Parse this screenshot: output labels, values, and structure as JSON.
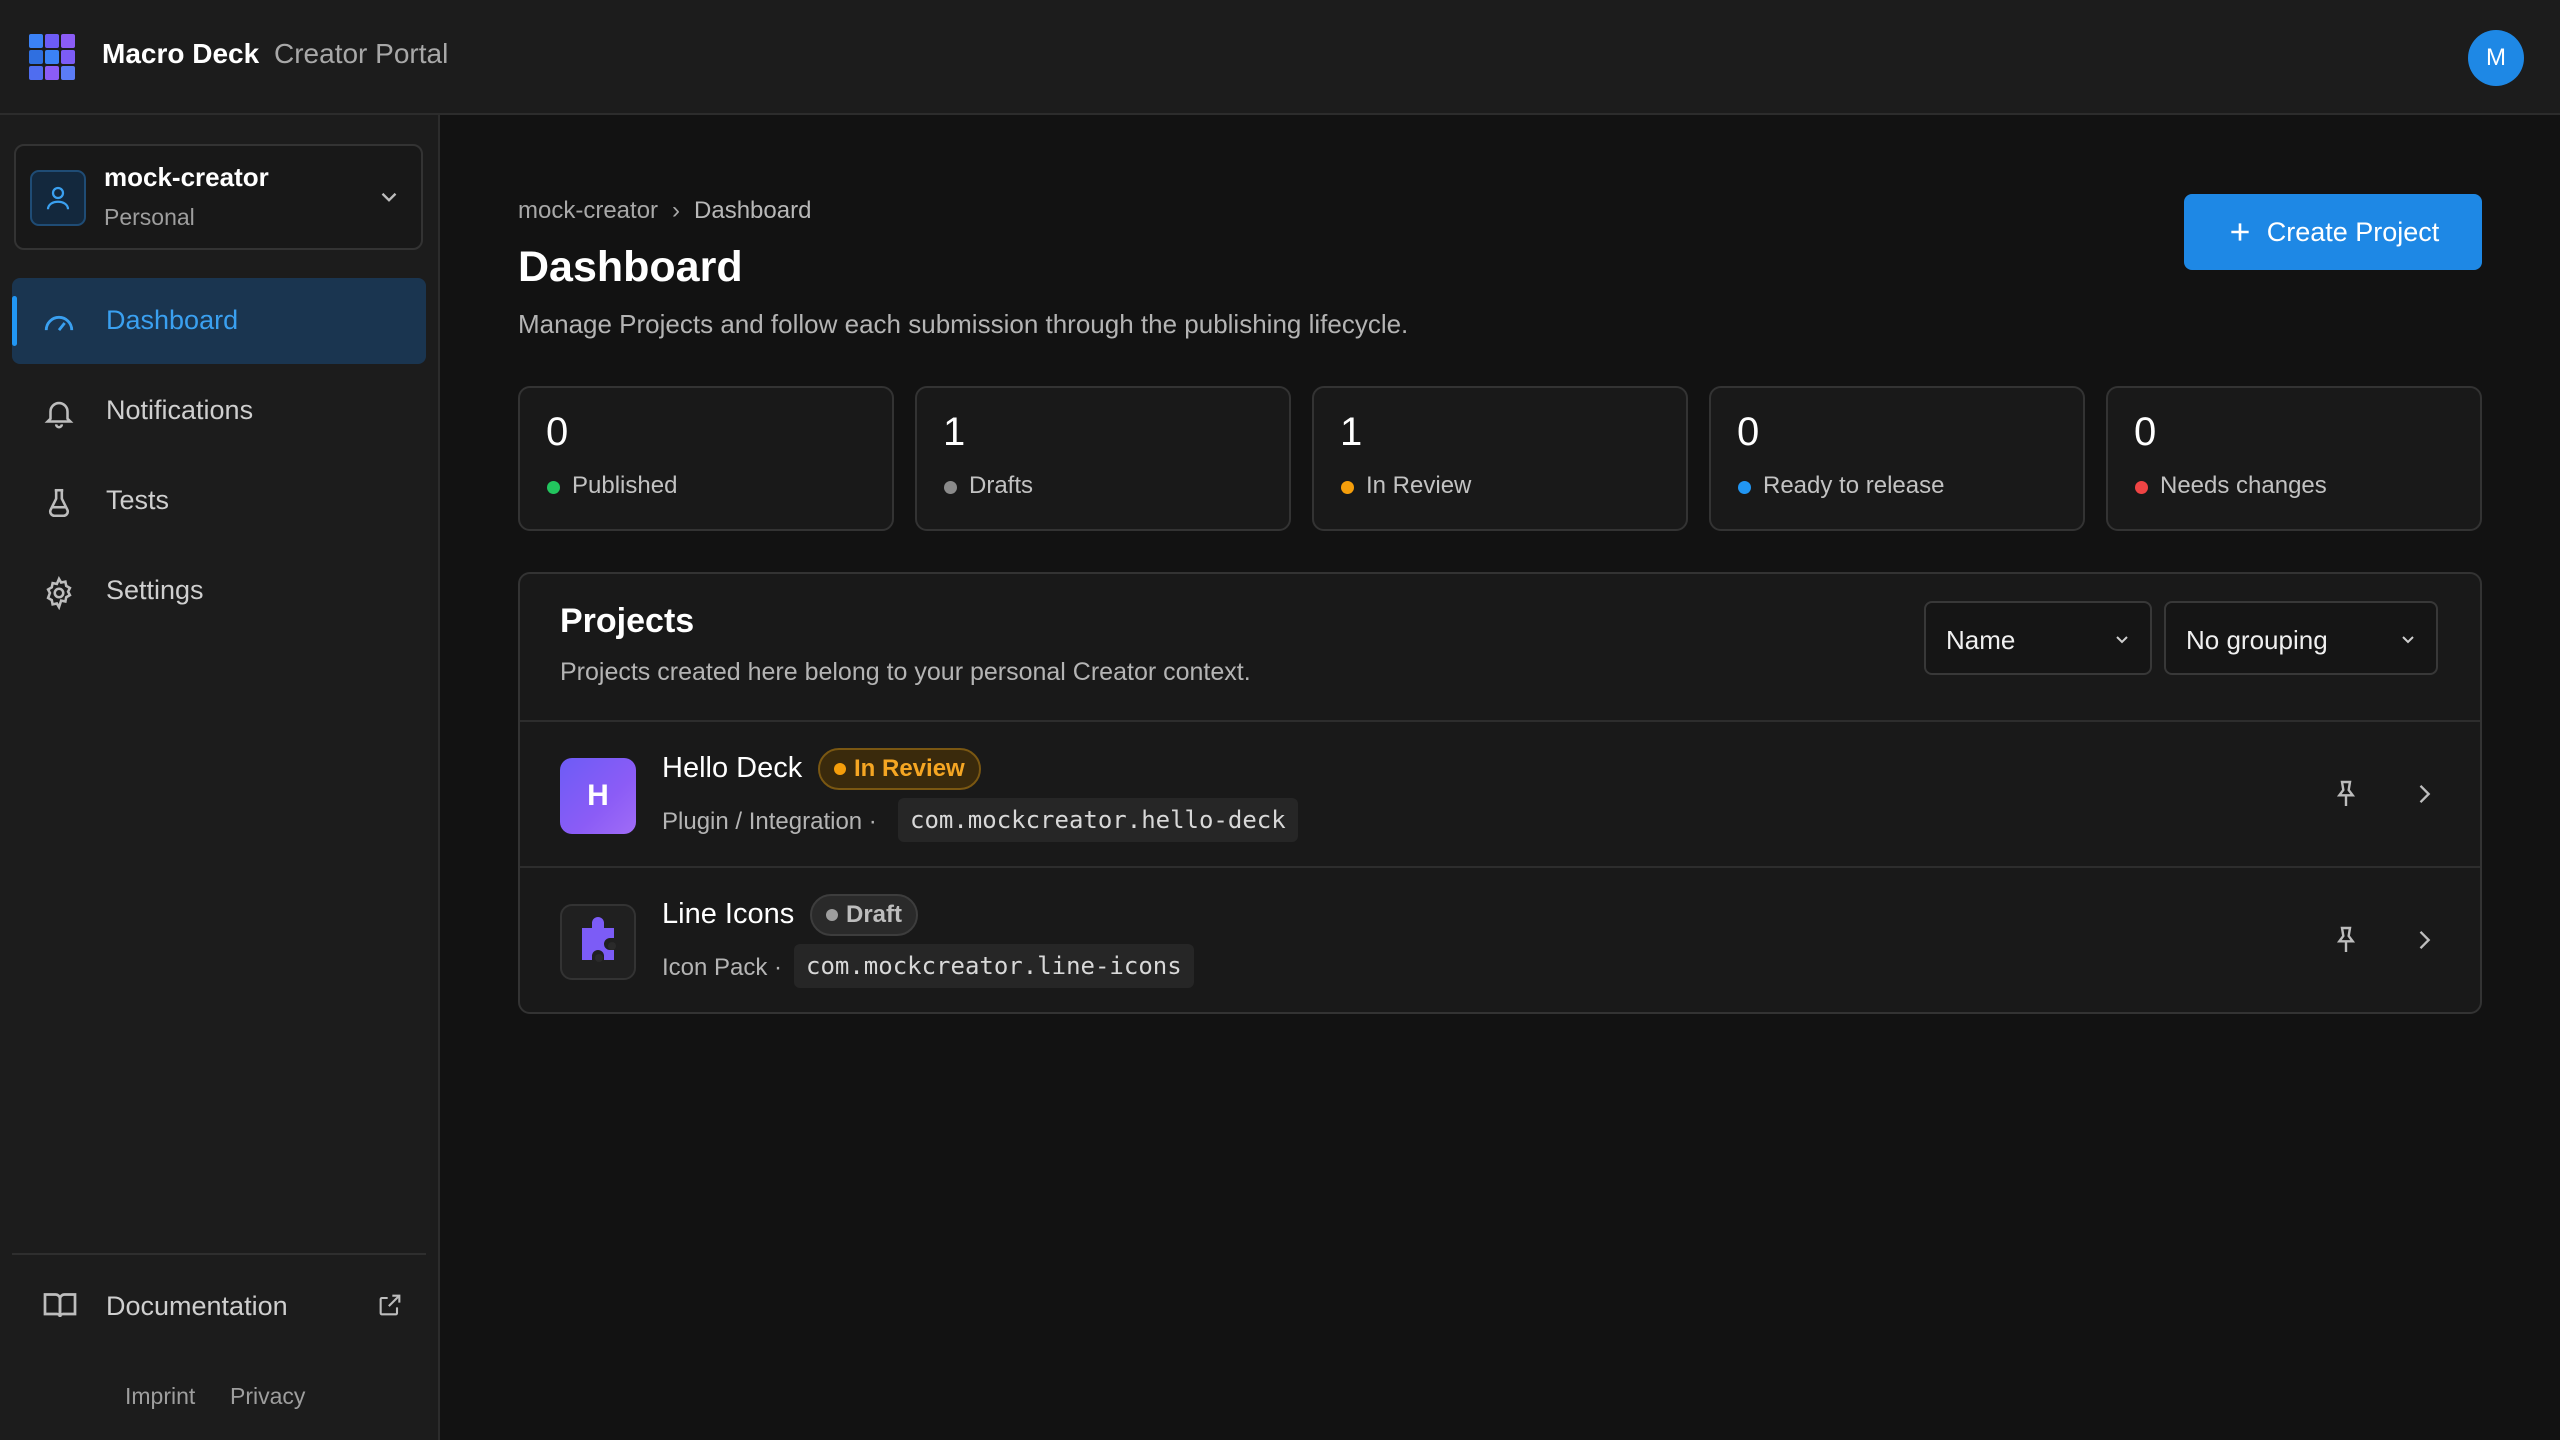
{
  "header": {
    "brand": "Macro Deck",
    "brand_sub": "Creator Portal",
    "avatar_letter": "M",
    "logo_icon": "grid-logo-icon"
  },
  "sidebar": {
    "context": {
      "name": "mock-creator",
      "type": "Personal",
      "icon": "user-icon"
    },
    "items": [
      {
        "label": "Dashboard",
        "icon": "gauge-icon",
        "active": true
      },
      {
        "label": "Notifications",
        "icon": "bell-icon",
        "active": false
      },
      {
        "label": "Tests",
        "icon": "flask-icon",
        "active": false
      },
      {
        "label": "Settings",
        "icon": "gear-icon",
        "active": false
      }
    ],
    "documentation": {
      "label": "Documentation",
      "icon": "book-icon",
      "external_icon": "external-link-icon"
    },
    "footer": {
      "imprint": "Imprint",
      "privacy": "Privacy"
    }
  },
  "main": {
    "breadcrumb": {
      "root": "mock-creator",
      "separator": "›",
      "current": "Dashboard"
    },
    "title": "Dashboard",
    "subtitle": "Manage Projects and follow each submission through the publishing lifecycle.",
    "create_button": "Create Project",
    "stats": [
      {
        "count": "0",
        "label": "Published",
        "color": "#22c55e"
      },
      {
        "count": "1",
        "label": "Drafts",
        "color": "#8a8a8a"
      },
      {
        "count": "1",
        "label": "In Review",
        "color": "#f59e0b"
      },
      {
        "count": "0",
        "label": "Ready to release",
        "color": "#2196f3"
      },
      {
        "count": "0",
        "label": "Needs changes",
        "color": "#ef4444"
      }
    ],
    "projects": {
      "title": "Projects",
      "subtitle": "Projects created here belong to your personal Creator context.",
      "sort_value": "Name",
      "grouping_value": "No grouping",
      "rows": [
        {
          "initial": "H",
          "name": "Hello Deck",
          "status": "In Review",
          "status_color": "#f59e0b",
          "type": "Plugin / Integration ·",
          "id": "com.mockcreator.hello-deck"
        },
        {
          "initial": "",
          "name": "Line Icons",
          "status": "Draft",
          "status_color": "#9e9e9e",
          "type": "Icon Pack ·",
          "id": "com.mockcreator.line-icons"
        }
      ]
    }
  },
  "colors": {
    "accent": "#1e88e5",
    "background": "#121212",
    "surface": "#191919"
  }
}
